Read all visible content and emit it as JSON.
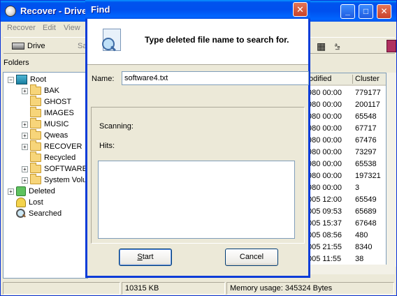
{
  "main": {
    "title": "Recover - Drive",
    "menu": [
      "Recover",
      "Edit",
      "View"
    ],
    "toolbar": {
      "drive_label": "Drive",
      "cut_label": "Sa"
    },
    "folders_label": "Folders",
    "tree": [
      {
        "label": "Root",
        "icon": "root-drive-icon",
        "expander": "−"
      },
      {
        "label": "BAK",
        "icon": "folder-icon",
        "expander": "+"
      },
      {
        "label": "GHOST",
        "icon": "folder-icon",
        "expander": ""
      },
      {
        "label": "IMAGES",
        "icon": "folder-icon",
        "expander": ""
      },
      {
        "label": "MUSIC",
        "icon": "folder-icon",
        "expander": "+"
      },
      {
        "label": "Qweas",
        "icon": "folder-icon",
        "expander": "+"
      },
      {
        "label": "RECOVER",
        "icon": "folder-icon",
        "expander": "+"
      },
      {
        "label": "Recycled",
        "icon": "folder-icon",
        "expander": ""
      },
      {
        "label": "SOFTWARE",
        "icon": "folder-icon",
        "expander": "+"
      },
      {
        "label": "System Volu",
        "icon": "folder-icon",
        "expander": "+"
      },
      {
        "label": "Deleted",
        "icon": "deleted-icon",
        "expander": "+"
      },
      {
        "label": "Lost",
        "icon": "lost-icon",
        "expander": ""
      },
      {
        "label": "Searched",
        "icon": "searched-icon",
        "expander": ""
      }
    ],
    "list": {
      "headers": [
        "odified",
        "Cluster"
      ],
      "rows": [
        [
          "980 00:00",
          "779177"
        ],
        [
          "980 00:00",
          "200117"
        ],
        [
          "980 00:00",
          "65548"
        ],
        [
          "980 00:00",
          "67717"
        ],
        [
          "980 00:00",
          "67476"
        ],
        [
          "980 00:00",
          "73297"
        ],
        [
          "980 00:00",
          "65538"
        ],
        [
          "980 00:00",
          "197321"
        ],
        [
          "980 00:00",
          "3"
        ],
        [
          "005 12:00",
          "65549"
        ],
        [
          "005 09:53",
          "65689"
        ],
        [
          "005 15:37",
          "67648"
        ],
        [
          "005 08:56",
          "480"
        ],
        [
          "005 21:55",
          "8340"
        ],
        [
          "005 11:55",
          "38"
        ]
      ]
    },
    "status": {
      "size": "10315 KB",
      "memory": "Memory usage: 345324 Bytes"
    }
  },
  "dialog": {
    "title": "Find",
    "close_glyph": "✕",
    "instruction": "Type deleted file name to search for.",
    "name_label": "Name:",
    "name_value": "software4.txt",
    "scanning_label": "Scanning:",
    "hits_label": "Hits:",
    "start_u": "S",
    "start_rest": "tart",
    "cancel_label": "Cancel"
  },
  "colors": {
    "titlebar": "#0053EE",
    "close": "#C8422A",
    "face": "#ECE9D8"
  }
}
